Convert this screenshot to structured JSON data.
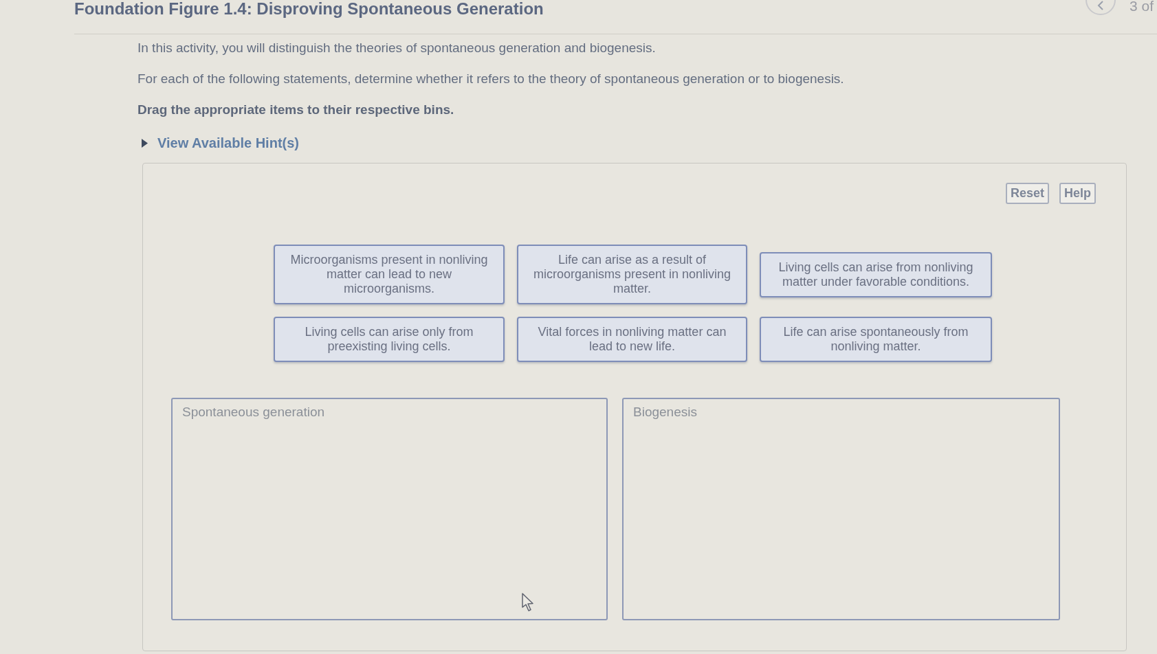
{
  "header": {
    "title": "Foundation Figure 1.4: Disproving Spontaneous Generation",
    "page_counter": "3 of"
  },
  "instructions": {
    "intro": "In this activity, you will distinguish the theories of spontaneous generation and biogenesis.",
    "question": "For each of the following statements, determine whether it refers to the theory of spontaneous generation or to biogenesis.",
    "task": "Drag the appropriate items to their respective bins."
  },
  "hint": {
    "label": "View Available Hint(s)",
    "expanded": false
  },
  "activity": {
    "buttons": [
      {
        "label": "Reset"
      },
      {
        "label": "Help"
      }
    ],
    "items": [
      "Microorganisms present in nonliving matter can lead to new microorganisms.",
      "Life can arise as a result of microorganisms present in nonliving matter.",
      "Living cells can arise from nonliving matter under favorable conditions.",
      "Living cells can arise only from preexisting living cells.",
      "Vital forces in nonliving matter can lead to new life.",
      "Life can arise spontaneously from nonliving matter."
    ],
    "bins": [
      {
        "label": "Spontaneous generation"
      },
      {
        "label": "Biogenesis"
      }
    ]
  }
}
